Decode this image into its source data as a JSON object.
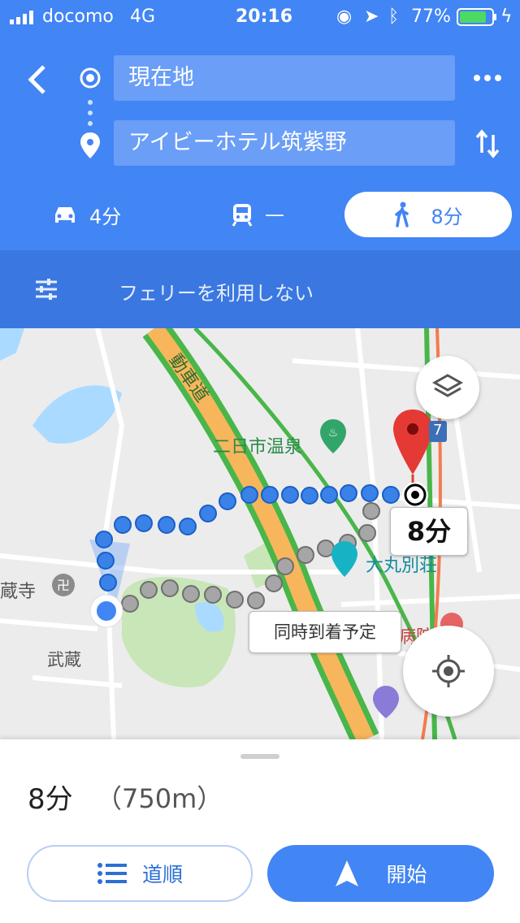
{
  "status_bar": {
    "carrier": "docomo",
    "network": "4G",
    "time": "20:16",
    "battery": "77%"
  },
  "route": {
    "origin": "現在地",
    "destination": "アイビーホテル筑紫野"
  },
  "modes": {
    "drive": "4分",
    "transit": "—",
    "walk": "8分"
  },
  "options": {
    "label": "フェリーを利用しない"
  },
  "map": {
    "labels": {
      "road": "動車道",
      "onsen": "二日市温泉",
      "daimaru": "大丸別荘",
      "temple": "蔵寺",
      "musashi": "武蔵",
      "hospital": "病院",
      "route_number": "7"
    },
    "eta_bubble": "8分",
    "callout": "同時到着予定"
  },
  "summary": {
    "duration": "8分",
    "distance": "（750m）"
  },
  "buttons": {
    "steps": "道順",
    "start": "開始"
  },
  "colors": {
    "primary": "#4285f4",
    "route": "#3b82e8",
    "alt_route": "#a6a6a6",
    "pin": "#e53935"
  }
}
